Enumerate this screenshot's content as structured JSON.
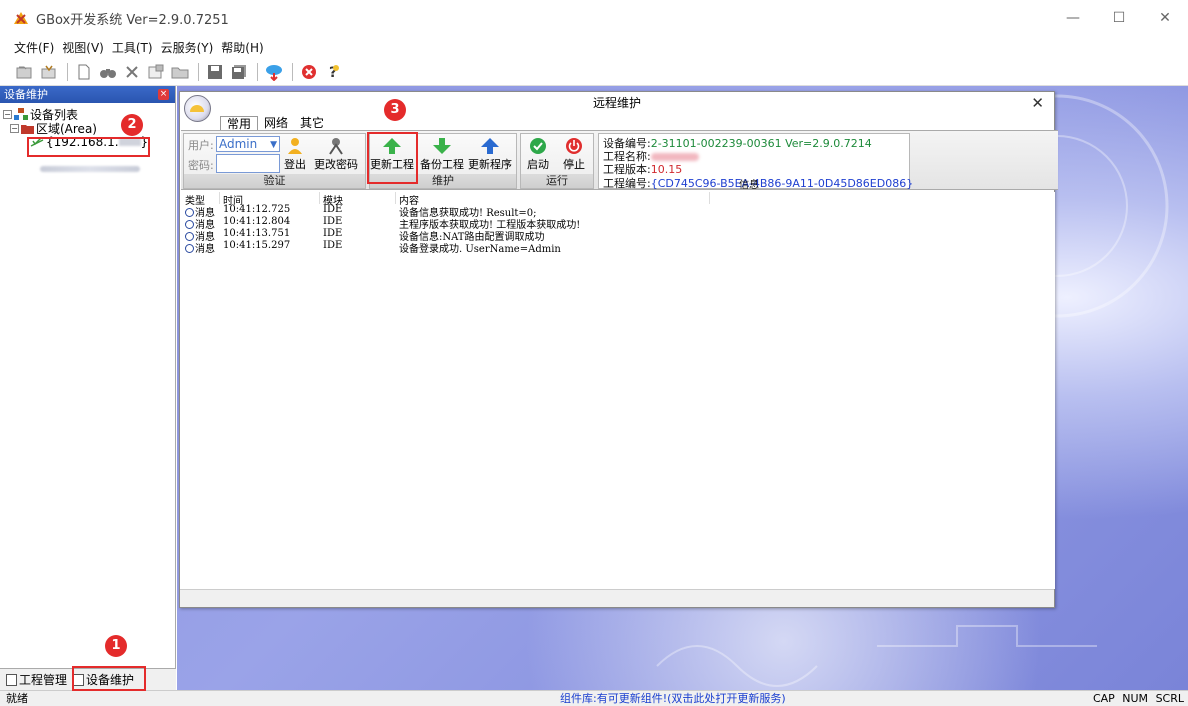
{
  "window": {
    "title": "GBox开发系统 Ver=2.9.0.7251",
    "controls": {
      "minimize": "—",
      "maximize": "☐",
      "close": "✕"
    }
  },
  "menu": [
    "文件(F)",
    "视图(V)",
    "工具(T)",
    "云服务(Y)",
    "帮助(H)"
  ],
  "left_panel": {
    "title": "设备维护",
    "tree": {
      "root": "设备列表",
      "area": "区域(Area)",
      "device": "{192.168.1.",
      "device_suffix": "}"
    },
    "tabs": [
      "工程管理",
      "设备维护"
    ]
  },
  "dialog": {
    "title": "远程维护",
    "tabs": [
      "常用",
      "网络",
      "其它"
    ],
    "auth": {
      "user_label": "用户:",
      "user_value": "Admin",
      "pwd_label": "密码:",
      "logout": "登出",
      "change_pwd": "更改密码",
      "group": "验证"
    },
    "maintain": {
      "update_project": "更新工程",
      "backup_project": "备份工程",
      "update_program": "更新程序",
      "group": "维护"
    },
    "run": {
      "start": "启动",
      "stop": "停止",
      "group": "运行"
    },
    "info": {
      "device_no_label": "设备编号:",
      "device_no": "2-31101-002239-00361 Ver=2.9.0.7214",
      "project_name_label": "工程名称:",
      "project_ver_label": "工程版本:",
      "project_ver": "10.15",
      "project_no_label": "工程编号:",
      "project_no": "{CD745C96-B5EA-4B86-9A11-0D45D86ED086}",
      "group": "信息"
    },
    "log": {
      "headers": [
        "类型",
        "时间",
        "模块",
        "内容"
      ],
      "rows": [
        {
          "type": "消息",
          "time": "10:41:12.725",
          "module": "IDE",
          "content": "设备信息获取成功! Result=0;"
        },
        {
          "type": "消息",
          "time": "10:41:12.804",
          "module": "IDE",
          "content": "主程序版本获取成功! 工程版本获取成功!"
        },
        {
          "type": "消息",
          "time": "10:41:13.751",
          "module": "IDE",
          "content": "设备信息:NAT路由配置调取成功"
        },
        {
          "type": "消息",
          "time": "10:41:15.297",
          "module": "IDE",
          "content": "设备登录成功. UserName=Admin"
        }
      ]
    }
  },
  "status": {
    "left": "就绪",
    "center": "组件库:有可更新组件!(双击此处打开更新服务)",
    "indicators": [
      "CAP",
      "NUM",
      "SCRL"
    ]
  },
  "callouts": [
    "1",
    "2",
    "3"
  ],
  "colors": {
    "accent_red": "#e42b2b",
    "title_blue": "#2a55b0",
    "link_blue": "#1a3fd0"
  }
}
